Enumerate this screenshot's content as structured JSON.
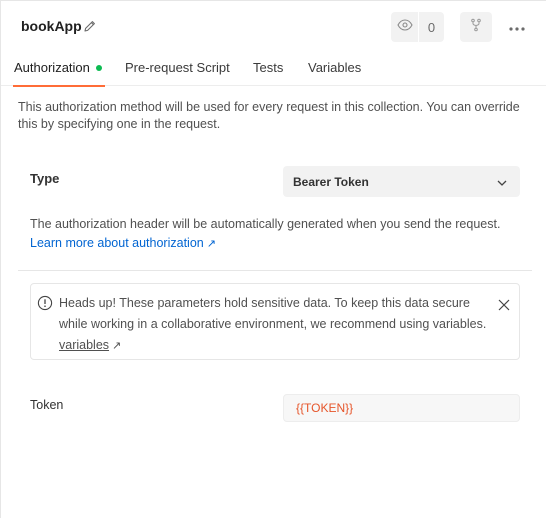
{
  "header": {
    "title": "bookApp",
    "watch_count": "0",
    "icons": [
      "pencil-icon",
      "eye-icon",
      "fork-icon",
      "more-icon"
    ]
  },
  "tabs": [
    {
      "label": "Authorization",
      "active": true
    },
    {
      "label": "Pre-request Script",
      "active": false
    },
    {
      "label": "Tests",
      "active": false
    },
    {
      "label": "Variables",
      "active": false
    }
  ],
  "description": "This authorization method will be used for every request in this collection. You can override this by specifying one in the request.",
  "auth": {
    "type_label": "Type",
    "type_value": "Bearer Token",
    "info_text": "The authorization header will be automatically generated when you send the request.",
    "learn_more": "Learn more about authorization",
    "learn_more_arrow": "↗"
  },
  "alert": {
    "text": "Heads up! These parameters hold sensitive data. To keep this data secure while working in a collaborative environment, we recommend using variables.",
    "link": "variables",
    "link_arrow": "↗"
  },
  "token": {
    "label": "Token",
    "value": "{{TOKEN}}"
  },
  "colors": {
    "accent": "#ff6c37",
    "active_dot": "#0cbb52",
    "link": "#0265d2",
    "variable": "#e6552a"
  }
}
